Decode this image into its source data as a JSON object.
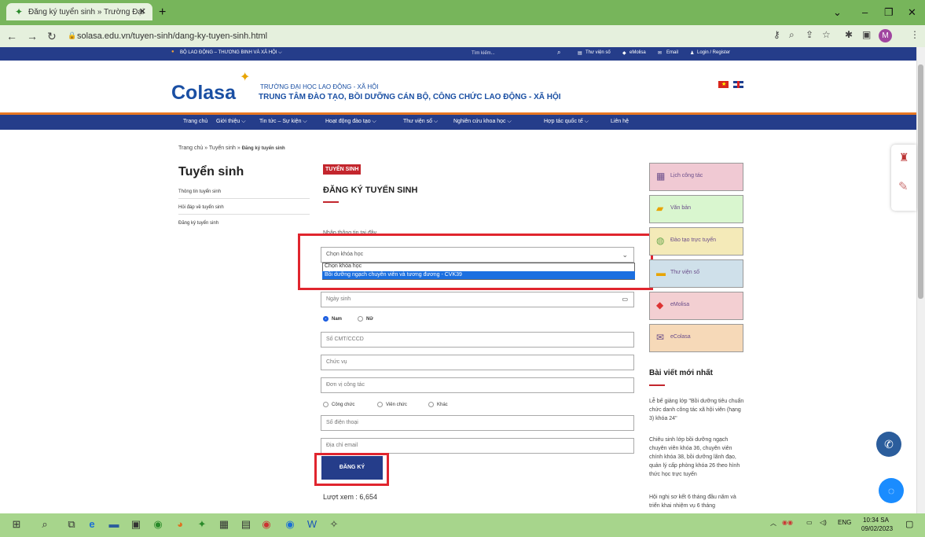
{
  "browser": {
    "tab_title": "Đăng ký tuyển sinh » Trường Đại",
    "tab_close": "✕",
    "new_tab": "+",
    "url": "solasa.edu.vn/tuyen-sinh/dang-ky-tuyen-sinh.html",
    "avatar": "M"
  },
  "topbar": {
    "ministry": "BỘ LAO ĐỘNG – THƯƠNG BINH VÀ XÃ HỘI ⌵",
    "search_placeholder": "Tìm kiếm...",
    "library": "Thư viện số",
    "emolisa": "eMolisa",
    "email": "Email",
    "login": "Login / Register"
  },
  "header": {
    "logo": "Colasa",
    "school": "TRƯỜNG ĐẠI HỌC LAO ĐỘNG - XÃ HỘI",
    "center": "TRUNG TÂM ĐÀO TẠO, BỒI DƯỠNG CÁN BỘ, CÔNG CHỨC LAO ĐỘNG - XÃ HỘI"
  },
  "nav": [
    "Trang chủ",
    "Giới thiệu ⌵",
    "Tin tức – Sự kiện ⌵",
    "Hoạt động đào tạo ⌵",
    "Thư viện số ⌵",
    "Nghiên cứu khoa học ⌵",
    "Hợp tác quốc tế ⌵",
    "Liên hệ"
  ],
  "breadcrumb": {
    "a": "Trang chủ » Tuyển sinh » ",
    "b": "Đăng ký tuyển sinh"
  },
  "sidebar": {
    "title": "Tuyển sinh",
    "items": [
      "Thông tin tuyển sinh",
      "Hỏi đáp về tuyển sinh",
      "Đăng ký tuyển sinh"
    ]
  },
  "form": {
    "badge": "TUYỂN SINH",
    "title": "ĐĂNG KÝ TUYỂN SINH",
    "prompt": "Nhập thông tin tại đây",
    "course_selected": "Chọn khóa học",
    "course_options": [
      "Chọn khóa học",
      "Bồi dưỡng ngạch chuyên viên và tương đương - CVK39"
    ],
    "dob": "Ngày sinh",
    "male": "Nam",
    "female": "Nữ",
    "id_number": "Số CMT/CCCD",
    "position": "Chức vụ",
    "workplace": "Đơn vị công tác",
    "type_civil": "Công chức",
    "type_employee": "Viên chức",
    "type_other": "Khác",
    "phone": "Số điện thoại",
    "email": "Địa chỉ email",
    "submit": "ĐĂNG KÝ",
    "views": "Lượt xem : 6,654"
  },
  "cards": [
    {
      "label": "Lịch công tác",
      "color": "#f0c9d3",
      "icon": "calendar-icon"
    },
    {
      "label": "Văn bản",
      "color": "#d9f6cf",
      "icon": "folder-icon"
    },
    {
      "label": "Đào tạo trực tuyến",
      "color": "#f4eab8",
      "icon": "globe-icon"
    },
    {
      "label": "Thư viện số",
      "color": "#cfe0ea",
      "icon": "book-icon"
    },
    {
      "label": "eMolisa",
      "color": "#f3cfd2",
      "icon": "tag-icon"
    },
    {
      "label": "eColasa",
      "color": "#f6d9b8",
      "icon": "mail-icon"
    }
  ],
  "news": {
    "title": "Bài viết mới nhất",
    "items": [
      "Lễ bế giảng lớp \"Bồi dưỡng tiêu chuẩn chức danh công tác xã hội viên (hạng 3) khóa 24\"",
      "Chiêu sinh lớp bồi dưỡng ngạch chuyên viên khóa 36, chuyên viên chính khóa 38, bồi dưỡng lãnh đạo, quản lý cấp phòng khóa 26 theo hình thức học trực tuyến",
      "Hội nghị sơ kết 6 tháng đầu năm và triển khai nhiệm vụ 6 tháng"
    ]
  },
  "taskbar": {
    "lang": "ENG",
    "time": "10:34 SA",
    "date": "09/02/2023"
  }
}
